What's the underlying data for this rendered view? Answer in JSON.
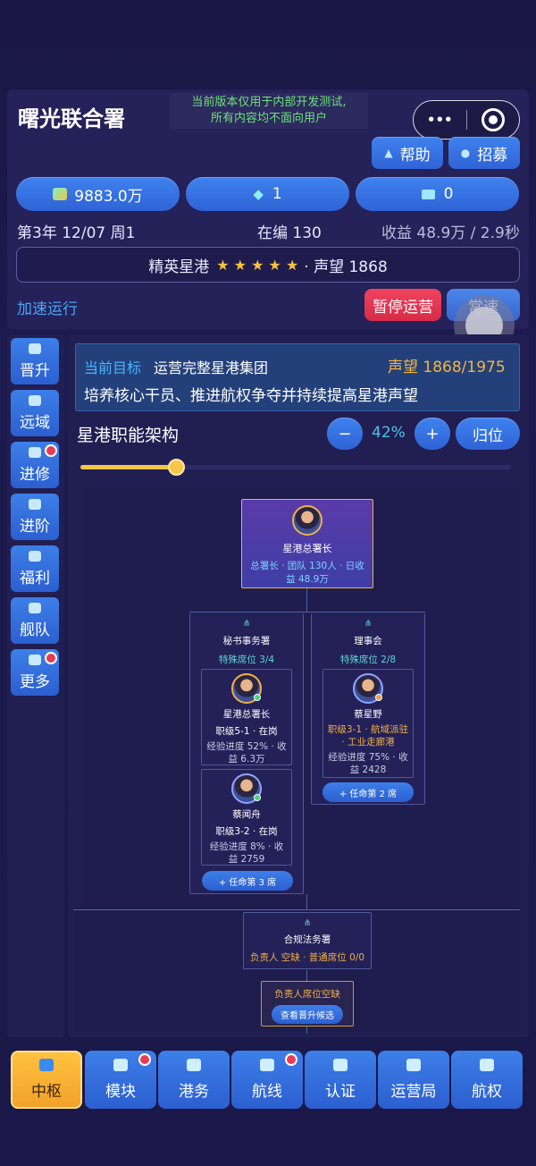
{
  "header": {
    "title": "曙光联合署",
    "notice_line1": "当前版本仅用于内部开发测试,",
    "notice_line2": "所有内容均不面向用户",
    "menu_label": "•••",
    "help_label": "帮助",
    "recruit_label": "招募"
  },
  "resources": {
    "money": "9883.0万",
    "diamond": "1",
    "ticket": "0"
  },
  "status": {
    "date": "第3年 12/07 周1",
    "staff": "在编 130",
    "income": "收益 48.9万 / 2.9秒"
  },
  "rank": {
    "label": "精英星港",
    "stars": "★ ★ ★ ★ ★",
    "reputation": "· 声望 1868",
    "rating": 5
  },
  "controls": {
    "speed_up": "加速运行",
    "pause": "暂停运营",
    "normal": "常速"
  },
  "goal": {
    "label": "当前目标",
    "name": "运营完整星港集团",
    "progress": "声望 1868/1975",
    "desc": "培养核心干员、推进航权争夺并持续提高星港声望"
  },
  "org": {
    "title": "星港职能架构",
    "minus": "−",
    "zoom": "42%",
    "plus": "+",
    "reset": "归位",
    "zoom_fraction": 0.42,
    "root": {
      "name": "星港总署长",
      "info": "总署长 · 团队 130人 · 日收益 48.9万"
    },
    "dept1": {
      "name": "秘书事务署",
      "seats": "特殊席位 3/4",
      "member1": {
        "name": "星港总署长",
        "level": "职级5-1 · 在岗",
        "exp": "经验进度 52% · 收益 6.3万"
      },
      "member2": {
        "name": "蔡闻舟",
        "level": "职级3-2 · 在岗",
        "exp": "经验进度 8% · 收益 2759"
      },
      "appoint": "+ 任命第 3 席"
    },
    "dept2": {
      "name": "理事会",
      "seats": "特殊席位 2/8",
      "member1": {
        "name": "蔡星野",
        "level": "职级3-1 · 航域派驻 · 工业走廊港",
        "exp": "经验进度 75% · 收益 2428"
      },
      "appoint": "+ 任命第 2 席"
    },
    "dept3": {
      "name": "合规法务署",
      "info": "负责人 空缺 · 普通席位 0/0",
      "vacant": "负责人席位空缺",
      "view": "查看晋升候选"
    }
  },
  "sidebar": {
    "items": [
      {
        "label": "晋升"
      },
      {
        "label": "远域"
      },
      {
        "label": "进修"
      },
      {
        "label": "进阶"
      },
      {
        "label": "福利"
      },
      {
        "label": "舰队"
      },
      {
        "label": "更多"
      }
    ]
  },
  "nav": {
    "items": [
      {
        "label": "中枢"
      },
      {
        "label": "模块"
      },
      {
        "label": "港务"
      },
      {
        "label": "航线"
      },
      {
        "label": "认证"
      },
      {
        "label": "运营局"
      },
      {
        "label": "航权"
      }
    ]
  },
  "colors": {
    "accent_blue": "#3d7fe8",
    "gold": "#f0b048",
    "danger": "#e8314f",
    "active_nav": "#f2a62a"
  }
}
